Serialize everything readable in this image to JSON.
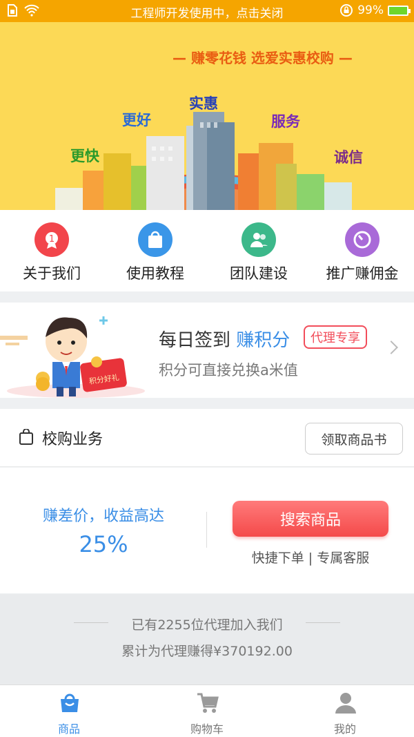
{
  "status_bar": {
    "message": "工程师开发使用中，点击关闭",
    "battery": "99%"
  },
  "banner": {
    "slogan": "— 赚零花钱 选爱实惠校购 —",
    "words": [
      "更快",
      "更好",
      "实惠",
      "服务",
      "诚信"
    ]
  },
  "quick_nav": {
    "items": [
      {
        "label": "关于我们",
        "icon": "medal-icon",
        "color": "#f2454b"
      },
      {
        "label": "使用教程",
        "icon": "bag-icon",
        "color": "#3a96e8"
      },
      {
        "label": "团队建设",
        "icon": "team-icon",
        "color": "#3cb88a"
      },
      {
        "label": "推广赚佣金",
        "icon": "clock-icon",
        "color": "#a96ad8"
      }
    ]
  },
  "signin": {
    "title_prefix": "每日签到",
    "title_highlight": "赚积分",
    "tag": "代理专享",
    "subtitle": "积分可直接兑换a米值",
    "envelope_text": "积分好礼"
  },
  "business": {
    "title": "校购业务",
    "claim_button": "领取商品书",
    "profit_line": "赚差价，收益高达",
    "profit_rate": "25%",
    "search_button": "搜索商品",
    "search_sub": "快捷下单 | 专属客服"
  },
  "stats": {
    "line1": "已有2255位代理加入我们",
    "line2": "累计为代理赚得¥370192.00"
  },
  "tab_bar": {
    "tabs": [
      {
        "label": "商品",
        "icon": "shopping-bag-icon",
        "active": true
      },
      {
        "label": "购物车",
        "icon": "cart-icon",
        "active": false
      },
      {
        "label": "我的",
        "icon": "user-icon",
        "active": false
      }
    ]
  }
}
